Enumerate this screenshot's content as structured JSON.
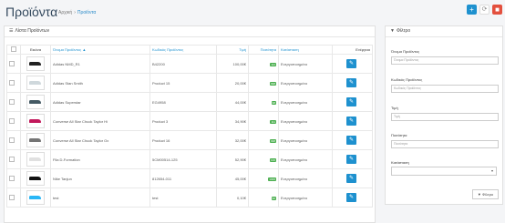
{
  "header": {
    "title": "Προϊόντα",
    "breadcrumb": [
      "Αρχική",
      "Προϊόντα"
    ],
    "actions": {
      "add_icon": "plus-icon",
      "refresh_icon": "refresh-icon",
      "delete_icon": "trash-icon"
    },
    "plus_glyph": "+",
    "refresh_glyph": "⟳",
    "delete_glyph": "■"
  },
  "product_list": {
    "heading": "Λίστα Προϊόντων",
    "heading_icon": "☰",
    "columns": {
      "image": "Εικόνα",
      "name": "Όνομα Προϊόντος ▲",
      "model": "Κωδικός Προϊόντος",
      "price": "Τιμή",
      "quantity": "Ποσότητα",
      "status": "Κατάσταση",
      "action": "Ενέργεια"
    },
    "edit_glyph": "✎",
    "rows": [
      {
        "name": "Adidas NMD_R1",
        "model": "B42200",
        "price": "100,00€",
        "qty": "112",
        "status": "Ενεργοποιημένο",
        "shoe_color": "#222222"
      },
      {
        "name": "Adidas Stan Smith",
        "model": "Product 15",
        "price": "20,00€",
        "qty": "998",
        "status": "Ενεργοποιημένο",
        "shoe_color": "#cfd8dc"
      },
      {
        "name": "Adidas Superstar",
        "model": "EG4958",
        "price": "44,00€",
        "qty": "98",
        "status": "Ενεργοποιημένο",
        "shoe_color": "#455a64"
      },
      {
        "name": "Converse All Star Chuck Taylor Hi",
        "model": "Product 3",
        "price": "34,90€",
        "qty": "111",
        "status": "Ενεργοποιημένο",
        "shoe_color": "#c2185b"
      },
      {
        "name": "Converse All Star Chuck Taylor Ox",
        "model": "Product 16",
        "price": "32,00€",
        "qty": "938",
        "status": "Ενεργοποιημένο",
        "shoe_color": "#757575"
      },
      {
        "name": "Fila D-Formation",
        "model": "5CM00514-125",
        "price": "52,90€",
        "qty": "100",
        "status": "Ενεργοποιημένο",
        "shoe_color": "#e0e0e0"
      },
      {
        "name": "Nike Tanjun",
        "model": "812654-011",
        "price": "45,00€",
        "qty": "1000",
        "status": "Ενεργοποιημένο",
        "shoe_color": "#111111"
      },
      {
        "name": "test",
        "model": "test",
        "price": "0,10€",
        "qty": "96",
        "status": "Ενεργοποιημένο",
        "shoe_color": "#29b6f6"
      }
    ]
  },
  "filter": {
    "heading": "Φίλτρο",
    "heading_icon": "▼",
    "name_label": "Όνομα Προϊόντος",
    "name_placeholder": "Όνομα Προϊόντος",
    "model_label": "Κωδικός Προϊόντος",
    "model_placeholder": "Κωδικός Προϊόντος",
    "price_label": "Τιμή",
    "price_placeholder": "Τιμή",
    "quantity_label": "Ποσότητα",
    "quantity_placeholder": "Ποσότητα",
    "status_label": "Κατάσταση",
    "status_value": "",
    "select_arrow": "▾",
    "button_label": "▼ Φίλτρο"
  }
}
